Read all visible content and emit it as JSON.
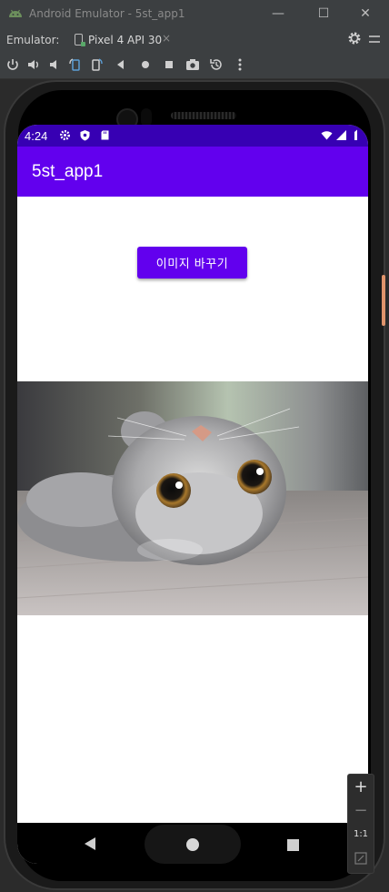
{
  "window": {
    "title": "Android Emulator - 5st_app1"
  },
  "tabbar": {
    "label": "Emulator:",
    "active_tab": "Pixel 4 API 30",
    "close_glyph": "×"
  },
  "toolbar": {
    "icons": [
      "power-icon",
      "volume-up-icon",
      "volume-down-icon",
      "rotate-left-icon",
      "rotate-right-icon",
      "back-icon",
      "home-icon",
      "overview-icon",
      "screenshot-icon",
      "snapshot-icon",
      "more-icon"
    ]
  },
  "window_controls": {
    "minimize": "—",
    "maximize": "☐",
    "close": "✕"
  },
  "phone": {
    "status_bar": {
      "time": "4:24",
      "color": "#3700b3"
    },
    "app_bar": {
      "title": "5st_app1",
      "color": "#6200ee"
    },
    "button": {
      "label": "이미지 바꾸기",
      "color": "#6200ee"
    },
    "image": {
      "subject": "cat-photo"
    }
  },
  "zoom": {
    "plus": "+",
    "minus": "−",
    "ratio": "1:1"
  },
  "colors": {
    "accent": "#6200ee",
    "status": "#3700b3",
    "ide_bg": "#3c3f41",
    "power_button": "#e0946c"
  }
}
